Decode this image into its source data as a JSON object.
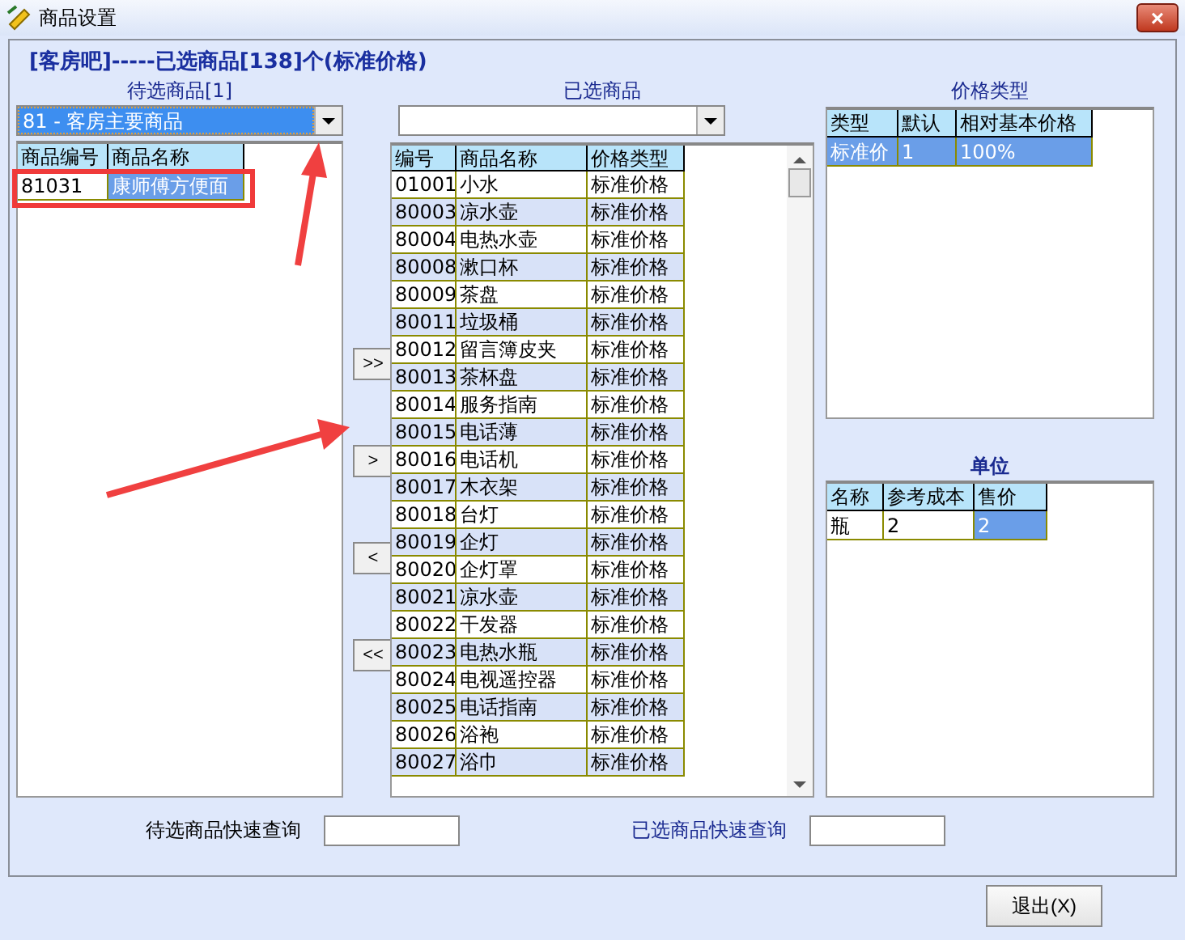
{
  "window": {
    "title": "商品设置",
    "close": "×"
  },
  "heading": "[客房吧]-----已选商品[138]个(标准价格)",
  "candidates": {
    "label": "待选商品[1]",
    "combo": {
      "value": "81 - 客房主要商品",
      "focused": true
    },
    "columns": [
      "商品编号",
      "商品名称"
    ],
    "rows": [
      {
        "cells": [
          {
            "text": "81031",
            "selected": false
          },
          {
            "text": "康师傅方便面",
            "selected": true
          }
        ]
      }
    ]
  },
  "move_buttons": [
    ">>",
    ">",
    "<",
    "<<"
  ],
  "chosen": {
    "label": "已选商品",
    "columns": [
      "编号",
      "商品名称",
      "价格类型"
    ],
    "rows": [
      [
        "01001",
        "小水",
        "标准价格"
      ],
      [
        "80003",
        "凉水壶",
        "标准价格"
      ],
      [
        "80004",
        "电热水壶",
        "标准价格"
      ],
      [
        "80008",
        "漱口杯",
        "标准价格"
      ],
      [
        "80009",
        "茶盘",
        "标准价格"
      ],
      [
        "80011",
        "垃圾桶",
        "标准价格"
      ],
      [
        "80012",
        "留言簿皮夹",
        "标准价格"
      ],
      [
        "80013",
        "茶杯盘",
        "标准价格"
      ],
      [
        "80014",
        "服务指南",
        "标准价格"
      ],
      [
        "80015",
        "电话薄",
        "标准价格"
      ],
      [
        "80016",
        "电话机",
        "标准价格"
      ],
      [
        "80017",
        "木衣架",
        "标准价格"
      ],
      [
        "80018",
        "台灯",
        "标准价格"
      ],
      [
        "80019",
        "企灯",
        "标准价格"
      ],
      [
        "80020",
        "企灯罩",
        "标准价格"
      ],
      [
        "80021",
        "凉水壶",
        "标准价格"
      ],
      [
        "80022",
        "干发器",
        "标准价格"
      ],
      [
        "80023",
        "电热水瓶",
        "标准价格"
      ],
      [
        "80024",
        "电视遥控器",
        "标准价格"
      ],
      [
        "80025",
        "电话指南",
        "标准价格"
      ],
      [
        "80026",
        "浴袍",
        "标准价格"
      ],
      [
        "80027",
        "浴巾",
        "标准价格"
      ]
    ]
  },
  "price_types": {
    "label": "价格类型",
    "columns": [
      "类型",
      "默认",
      "相对基本价格"
    ],
    "rows": [
      {
        "cells": [
          {
            "text": "标准价",
            "selected": true
          },
          {
            "text": "1",
            "selected": true
          },
          {
            "text": "100%",
            "selected": true
          }
        ]
      }
    ]
  },
  "units": {
    "label": "单位",
    "columns": [
      "名称",
      "参考成本",
      "售价"
    ],
    "rows": [
      {
        "cells": [
          {
            "text": "瓶",
            "selected": false
          },
          {
            "text": "2",
            "selected": false
          },
          {
            "text": "2",
            "selected": true
          }
        ]
      }
    ]
  },
  "search": [
    {
      "label": "待选商品快速查询",
      "highlight": false
    },
    {
      "label": "已选商品快速查询",
      "highlight": true
    }
  ],
  "exit_button": "退出(X)"
}
